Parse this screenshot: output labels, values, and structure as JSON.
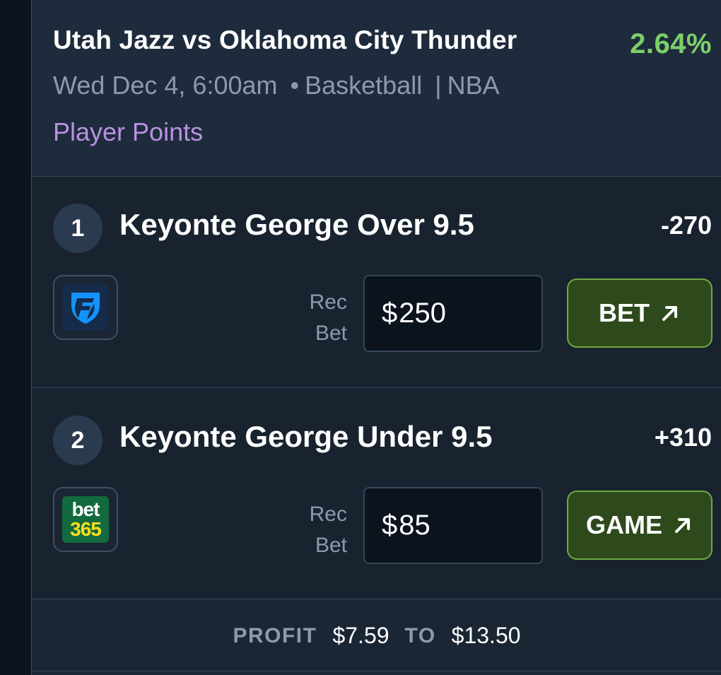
{
  "event": {
    "title": "Utah Jazz vs Oklahoma City Thunder",
    "edge_percent": "2.64%",
    "date_time": "Wed Dec 4, 6:00am",
    "bullet": "•",
    "sport": "Basketball",
    "divider": "|",
    "league": "NBA",
    "market": "Player Points"
  },
  "legs": [
    {
      "number": "1",
      "name": "Keyonte George Over 9.5",
      "odds": "-270",
      "book": "fanduel-logo",
      "rec_label_top": "Rec",
      "rec_label_bottom": "Bet",
      "currency": "$",
      "amount": "250",
      "action_label": "BET",
      "action_icon": "arrow-up-right-icon"
    },
    {
      "number": "2",
      "name": "Keyonte George Under 9.5",
      "odds": "+310",
      "book": "bet365-logo",
      "book_logo_top": "bet",
      "book_logo_bottom": "365",
      "rec_label_top": "Rec",
      "rec_label_bottom": "Bet",
      "currency": "$",
      "amount": "85",
      "action_label": "GAME",
      "action_icon": "arrow-up-right-icon"
    }
  ],
  "profit": {
    "label": "PROFIT",
    "min": "$7.59",
    "to_label": "TO",
    "max": "$13.50"
  },
  "colors": {
    "edge_green": "#7bcf6a",
    "market_purple": "#b992e2",
    "action_bg": "#2e4a1c",
    "action_border": "#6ea843"
  }
}
